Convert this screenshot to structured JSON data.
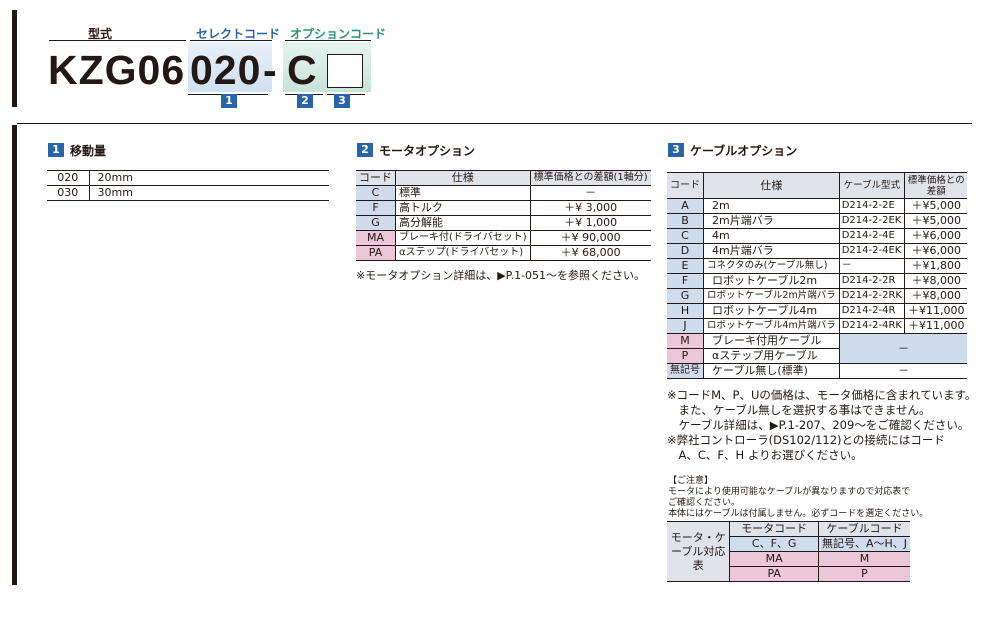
{
  "header": {
    "label_model": "型式",
    "label_select": "セレクトコード",
    "label_option": "オプションコード",
    "model_code": "KZG06",
    "select_code": "020",
    "dash": "-",
    "option_code": "C",
    "box1": "1",
    "box2": "2",
    "box3": "3"
  },
  "section1": {
    "num": "1",
    "title": "移動量",
    "rows": [
      [
        "020",
        "20mm"
      ],
      [
        "030",
        "30mm"
      ]
    ]
  },
  "section2": {
    "num": "2",
    "title": "モータオプション",
    "headers": [
      "コード",
      "仕様",
      "標準価格との差額(1軸分)"
    ],
    "rows": [
      [
        "C",
        "標準",
        "－"
      ],
      [
        "F",
        "高トルク",
        "＋¥ 3,000"
      ],
      [
        "G",
        "高分解能",
        "＋¥ 1,000"
      ],
      [
        "MA",
        "ブレーキ付(ドライバセット)",
        "＋¥ 90,000"
      ],
      [
        "PA",
        "αステップ(ドライバセット)",
        "＋¥ 68,000"
      ]
    ],
    "note": "※モータオプション詳細は、▶P.1-051〜を参照ください。"
  },
  "section3": {
    "num": "3",
    "title": "ケーブルオプション",
    "headers": [
      "コード",
      "仕様",
      "ケーブル型式",
      "標準価格との差額"
    ],
    "rows": [
      [
        "A",
        "2m",
        "D214-2-2E",
        "＋¥5,000"
      ],
      [
        "B",
        "2m片端バラ",
        "D214-2-2EK",
        "＋¥5,000"
      ],
      [
        "C",
        "4m",
        "D214-2-4E",
        "＋¥6,000"
      ],
      [
        "D",
        "4m片端バラ",
        "D214-2-4EK",
        "＋¥6,000"
      ],
      [
        "E",
        "コネクタのみ(ケーブル無し)",
        "－",
        "＋¥1,800"
      ],
      [
        "F",
        "ロボットケーブル2m",
        "D214-2-2R",
        "＋¥8,000"
      ],
      [
        "G",
        "ロボットケーブル2m片端バラ",
        "D214-2-2RK",
        "＋¥8,000"
      ],
      [
        "H",
        "ロボットケーブル4m",
        "D214-2-4R",
        "＋¥11,000"
      ],
      [
        "J",
        "ロボットケーブル4m片端バラ",
        "D214-2-4RK",
        "＋¥11,000"
      ]
    ],
    "rows_pink": [
      [
        "M",
        "ブレーキ付用ケーブル"
      ],
      [
        "P",
        "αステップ用ケーブル"
      ]
    ],
    "pink_merged": "－",
    "row_none": [
      "無記号",
      "ケーブル無し(標準)",
      "－"
    ],
    "notes": [
      "※コードM、P、Uの価格は、モータ価格に含まれています。",
      "　また、ケーブル無しを選択する事はできません。",
      "　ケーブル詳細は、▶P.1-207、209〜をご確認ください。",
      "※弊社コントローラ(DS102/112)との接続にはコード",
      "　A、C、F、H よりお選びください。"
    ],
    "caution_title": "【ご注意】",
    "caution_lines": [
      "モータにより使用可能なケーブルが異なりますので対応表で",
      "ご確認ください。",
      "本体にはケーブルは付属しません。必ずコードを選定ください。"
    ]
  },
  "compat": {
    "title": "モータ・ケーブル対応表",
    "headers": [
      "モータコード",
      "ケーブルコード"
    ],
    "rows": [
      [
        "C、F、G",
        "無記号、A〜H、J"
      ],
      [
        "MA",
        "M"
      ],
      [
        "PA",
        "P"
      ]
    ]
  }
}
